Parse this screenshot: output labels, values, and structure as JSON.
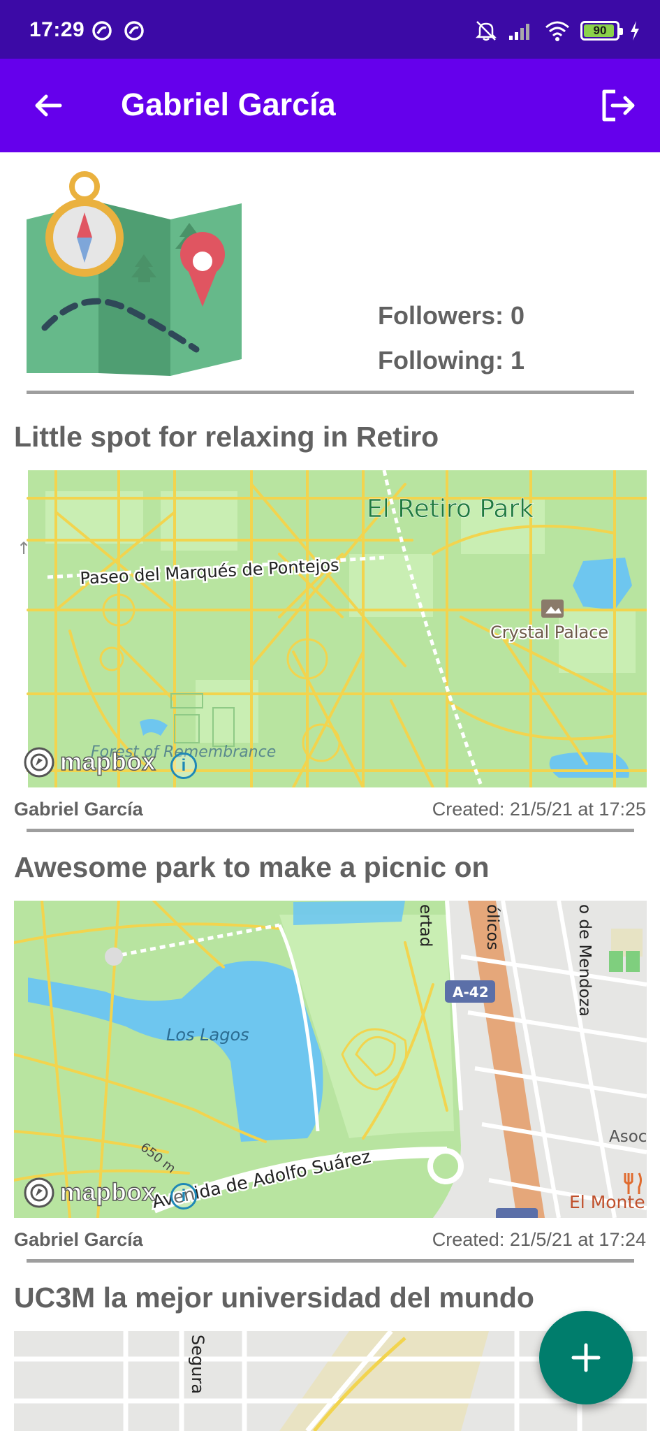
{
  "status_bar": {
    "time": "17:29",
    "battery_level": "90"
  },
  "header": {
    "title": "Gabriel García"
  },
  "profile": {
    "followers_label": "Followers: 0",
    "following_label": "Following: 1"
  },
  "posts": [
    {
      "title": "Little spot for relaxing in Retiro",
      "author": "Gabriel García",
      "created": "Created: 21/5/21 at 17:25",
      "map_labels": {
        "park": "El Retiro Park",
        "street": "Paseo del Marqués de Pontejos",
        "poi": "Crystal Palace",
        "forest": "Forest of Remembrance",
        "attribution": "mapbox",
        "info": "i"
      }
    },
    {
      "title": "Awesome park to make a picnic on",
      "author": "Gabriel García",
      "created": "Created: 21/5/21 at 17:24",
      "map_labels": {
        "lake": "Los Lagos",
        "avenue": "Avenida de Adolfo Suárez",
        "highway": "A-42",
        "distance": "650 m",
        "street_right": "o de Mendoza",
        "street_top": "ertad",
        "street_top2": "ólicos",
        "place": "El Monte",
        "place2": "Asoc",
        "attribution": "mapbox",
        "info": "i"
      }
    },
    {
      "title": "UC3M la mejor universidad del mundo",
      "map_labels": {
        "street": "Segura"
      }
    }
  ],
  "fab": {
    "label": "+"
  },
  "colors": {
    "status_bar": "#3c0aa6",
    "app_bar": "#6500ec",
    "fab": "#007d6c",
    "park_green": "#b6e59e",
    "water": "#6ec6ef",
    "road_yellow": "#f2d44e"
  }
}
